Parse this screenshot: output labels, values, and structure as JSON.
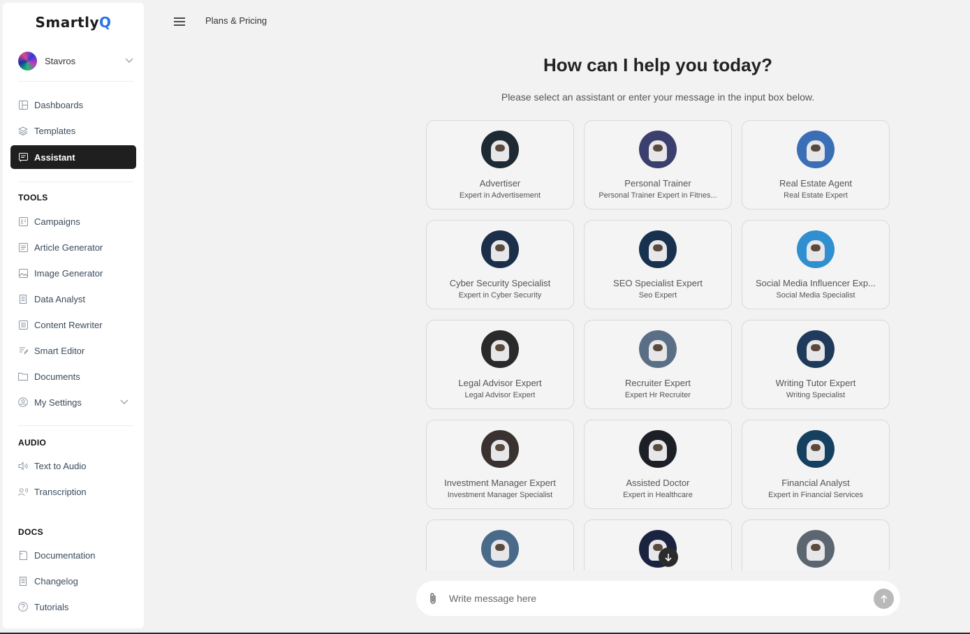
{
  "app": {
    "logo_main": "Smartly",
    "logo_accent": "Q"
  },
  "user": {
    "name": "Stavros"
  },
  "nav": {
    "main": [
      {
        "label": "Dashboards",
        "icon": "dashboard-icon"
      },
      {
        "label": "Templates",
        "icon": "layers-icon"
      },
      {
        "label": "Assistant",
        "icon": "chat-icon",
        "active": true
      }
    ],
    "tools_heading": "TOOLS",
    "tools": [
      {
        "label": "Campaigns",
        "icon": "campaign-icon"
      },
      {
        "label": "Article Generator",
        "icon": "article-icon"
      },
      {
        "label": "Image Generator",
        "icon": "image-icon"
      },
      {
        "label": "Data Analyst",
        "icon": "data-icon"
      },
      {
        "label": "Content Rewriter",
        "icon": "rewrite-icon"
      },
      {
        "label": "Smart Editor",
        "icon": "editor-icon"
      },
      {
        "label": "Documents",
        "icon": "folder-icon"
      },
      {
        "label": "My Settings",
        "icon": "user-circle-icon"
      }
    ],
    "audio_heading": "AUDIO",
    "audio": [
      {
        "label": "Text to Audio",
        "icon": "speaker-icon"
      },
      {
        "label": "Transcription",
        "icon": "voice-icon"
      }
    ],
    "docs_heading": "DOCS",
    "docs": [
      {
        "label": "Documentation",
        "icon": "book-icon"
      },
      {
        "label": "Changelog",
        "icon": "changelog-icon"
      },
      {
        "label": "Tutorials",
        "icon": "help-icon"
      }
    ]
  },
  "topbar": {
    "plans_label": "Plans & Pricing"
  },
  "main": {
    "title": "How can I help you today?",
    "subtitle": "Please select an assistant or enter your message in the input box below.",
    "assistants": [
      {
        "name": "Advertiser",
        "desc": "Expert in Advertisement",
        "bg": "#1e2a33"
      },
      {
        "name": "Personal Trainer",
        "desc": "Personal Trainer Expert in Fitnes...",
        "bg": "#3b3f6e"
      },
      {
        "name": "Real Estate Agent",
        "desc": "Real Estate Expert",
        "bg": "#3a6fb8"
      },
      {
        "name": "Cyber Security Specialist",
        "desc": "Expert in Cyber Security",
        "bg": "#1b2f4a"
      },
      {
        "name": "SEO Specialist Expert",
        "desc": "Seo Expert",
        "bg": "#17314f"
      },
      {
        "name": "Social Media Influencer Exp...",
        "desc": "Social Media Specialist",
        "bg": "#2f8fd0"
      },
      {
        "name": "Legal Advisor Expert",
        "desc": "Legal Advisor Expert",
        "bg": "#2a2a2a"
      },
      {
        "name": "Recruiter Expert",
        "desc": "Expert Hr Recruiter",
        "bg": "#5a6f86"
      },
      {
        "name": "Writing Tutor Expert",
        "desc": "Writing Specialist",
        "bg": "#1f3a5a"
      },
      {
        "name": "Investment Manager Expert",
        "desc": "Investment Manager Specialist",
        "bg": "#3a3230"
      },
      {
        "name": "Assisted Doctor",
        "desc": "Expert in Healthcare",
        "bg": "#1c1f26"
      },
      {
        "name": "Financial Analyst",
        "desc": "Expert in Financial Services",
        "bg": "#16405f"
      },
      {
        "name": "",
        "desc": "",
        "bg": "#4a6a8a"
      },
      {
        "name": "",
        "desc": "",
        "bg": "#1a2440"
      },
      {
        "name": "",
        "desc": "",
        "bg": "#5c6670"
      }
    ]
  },
  "input": {
    "placeholder": "Write message here"
  }
}
